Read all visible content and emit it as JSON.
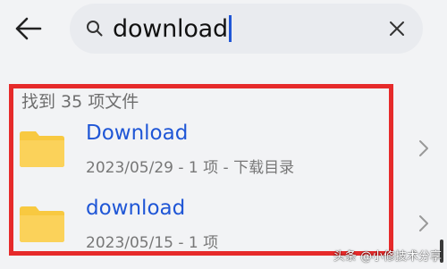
{
  "header": {
    "back_icon": "arrow-left-icon",
    "search": {
      "value": "download",
      "search_icon": "search-icon",
      "clear_icon": "close-icon"
    }
  },
  "results": {
    "count_label": "找到 35 项文件",
    "items": [
      {
        "name": "Download",
        "meta": "2023/05/29 - 1 项 - 下载目录",
        "icon": "folder-icon"
      },
      {
        "name": "download",
        "meta": "2023/05/15 - 1 项",
        "icon": "folder-icon"
      }
    ]
  },
  "annotation": {
    "highlight_color": "#e62a2a"
  },
  "watermark": {
    "text": "头条 @小修技术分享"
  },
  "colors": {
    "accent": "#1f56d6",
    "folder": "#f8c940",
    "background": "#f2f3f5"
  }
}
